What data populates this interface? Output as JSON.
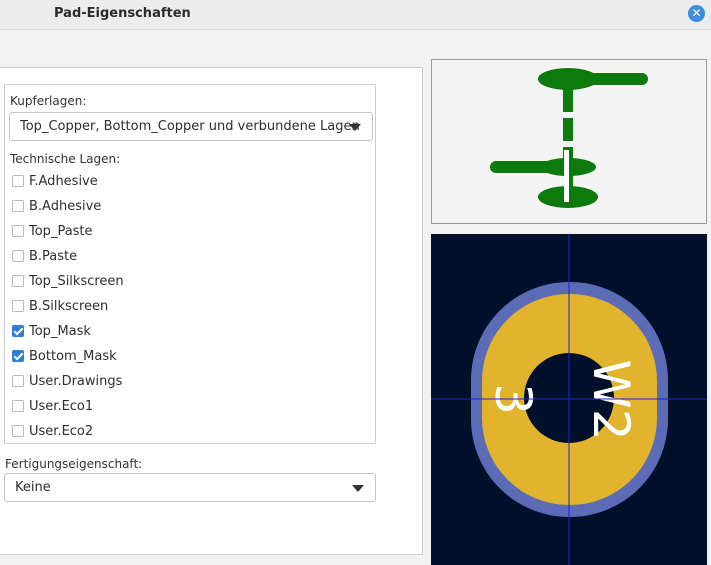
{
  "window": {
    "title": "Pad-Eigenschaften",
    "close_icon": "close-icon"
  },
  "copper": {
    "label": "Kupferlagen:",
    "selected": "Top_Copper, Bottom_Copper und verbundene Lagen"
  },
  "technical": {
    "label": "Technische Lagen:",
    "layers": [
      {
        "name": "F.Adhesive",
        "checked": false
      },
      {
        "name": "B.Adhesive",
        "checked": false
      },
      {
        "name": "Top_Paste",
        "checked": false
      },
      {
        "name": "B.Paste",
        "checked": false
      },
      {
        "name": "Top_Silkscreen",
        "checked": false
      },
      {
        "name": "B.Silkscreen",
        "checked": false
      },
      {
        "name": "Top_Mask",
        "checked": true
      },
      {
        "name": "Bottom_Mask",
        "checked": true
      },
      {
        "name": "User.Drawings",
        "checked": false
      },
      {
        "name": "User.Eco1",
        "checked": false
      },
      {
        "name": "User.Eco2",
        "checked": false
      }
    ]
  },
  "fabrication": {
    "label": "Fertigungseigenschaft:",
    "selected": "Keine"
  },
  "pad_preview": {
    "pad_number": "3",
    "net_name": "W2",
    "colors": {
      "background": "#01102a",
      "mask_ring": "#5b6bb5",
      "copper": "#e2b42e",
      "hole": "#01102a",
      "text": "#ffffff",
      "crosshair": "#1a22d8"
    }
  },
  "cross_section": {
    "colors": {
      "copper": "#0c7a0c",
      "barrel": "#ffffff"
    }
  }
}
